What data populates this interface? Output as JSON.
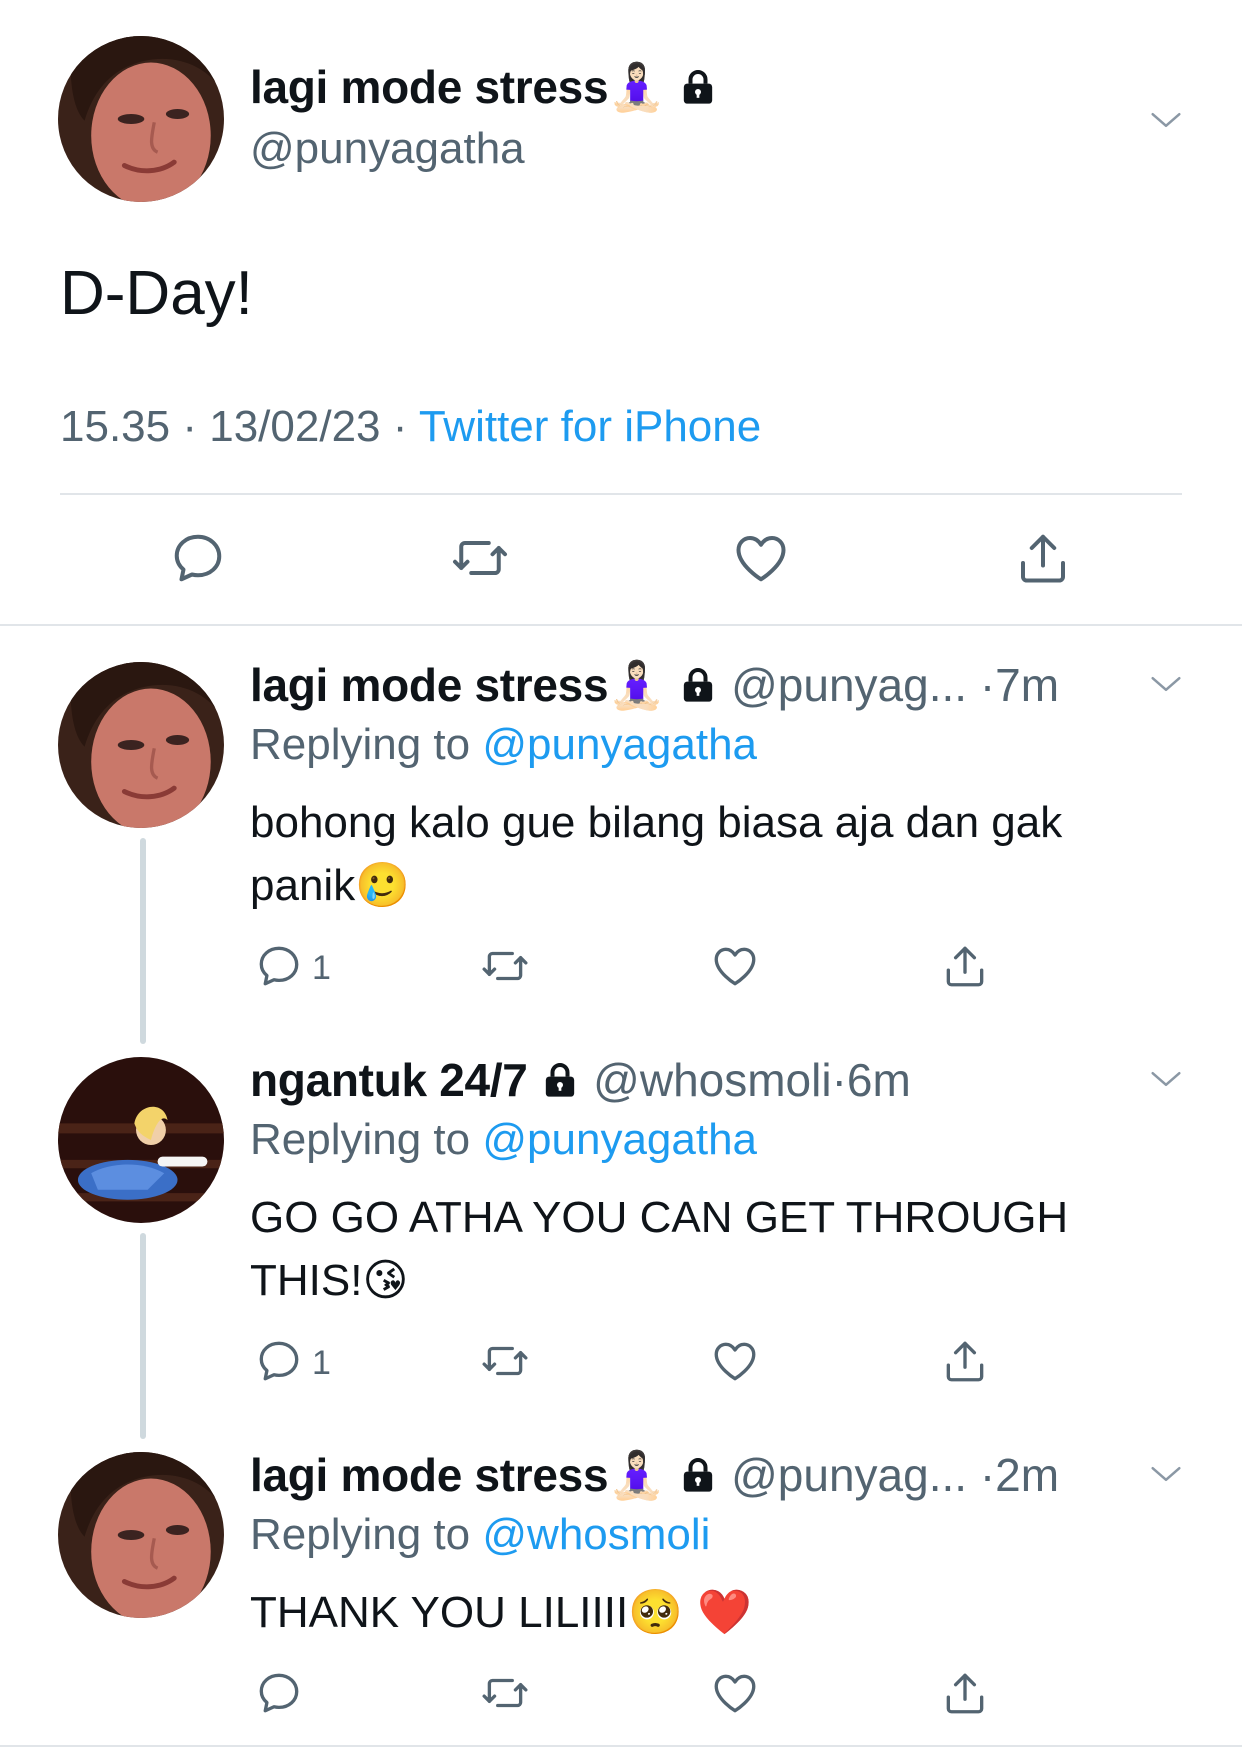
{
  "main_tweet": {
    "display_name": "lagi mode stress",
    "name_emoji": "🧘🏻‍♀️",
    "handle": "@punyagatha",
    "text": "D-Day!",
    "time": "15.35",
    "date": "13/02/23",
    "source": "Twitter for iPhone",
    "separator": "·"
  },
  "replies": [
    {
      "display_name": "lagi mode stress",
      "name_emoji": "🧘🏻‍♀️",
      "handle": "@punyag...",
      "time": "7m",
      "dot": "·",
      "replying_prefix": "Replying to",
      "replying_to": "@punyagatha",
      "text": "bohong kalo gue bilang biasa aja dan gak panik",
      "text_emoji": "🥲",
      "reply_count": "1"
    },
    {
      "display_name": "ngantuk 24/7",
      "name_emoji": "",
      "handle": "@whosmoli",
      "time": "6m",
      "dot": "·",
      "replying_prefix": "Replying to",
      "replying_to": "@punyagatha",
      "text": "GO GO ATHA YOU CAN GET THROUGH THIS!",
      "text_emoji": "😘",
      "reply_count": "1"
    },
    {
      "display_name": "lagi mode stress",
      "name_emoji": "🧘🏻‍♀️",
      "handle": "@punyag...",
      "time": "2m",
      "dot": "·",
      "replying_prefix": "Replying to",
      "replying_to": "@whosmoli",
      "text": "THANK YOU LILIIII",
      "text_emoji": "🥺 ❤️",
      "reply_count": ""
    }
  ],
  "icons": {
    "reply": "reply-bubble-icon",
    "retweet": "retweet-icon",
    "like": "heart-icon",
    "share": "share-icon",
    "lock": "lock-icon",
    "more": "chevron-down-icon"
  },
  "colors": {
    "link": "#1d9bf0",
    "secondary_text": "#536471",
    "primary_text": "#0f1419",
    "divider": "#e1e5e9"
  }
}
